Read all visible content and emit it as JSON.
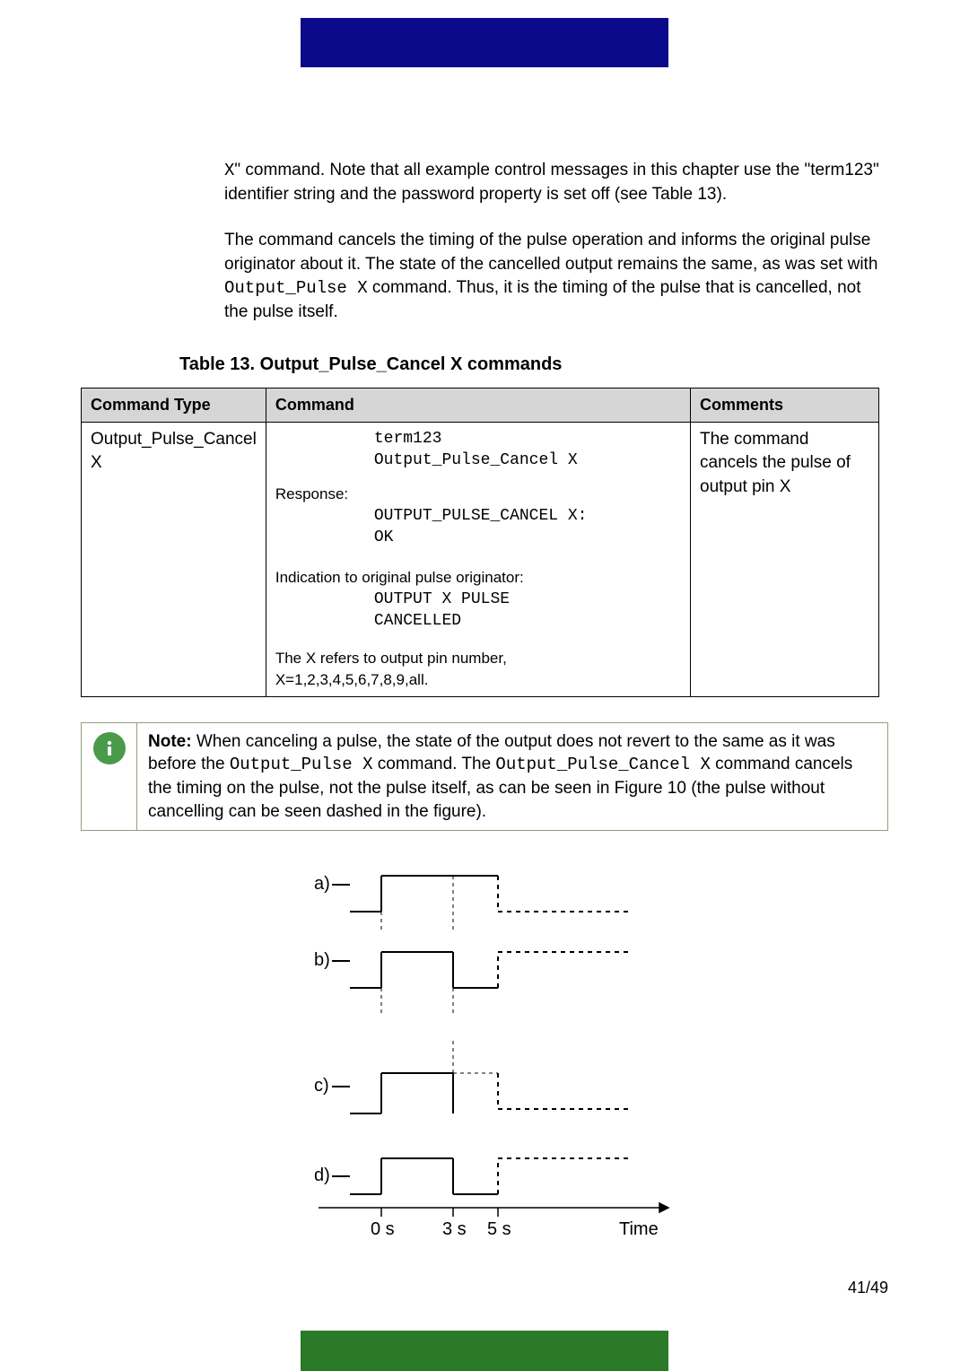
{
  "intro1_parts": {
    "p1": "X",
    "p2": "\" command. Note that all example control messages in this chapter use the \"term123\" identifier string and the password property is set off (see Table 13)."
  },
  "intro2_parts": {
    "p1": "The command cancels the timing of the pulse operation and informs the original pulse originator about it. The state of the cancelled output remains the same, as was set with ",
    "cmd": "Output_Pulse X",
    "p2": " command. Thus, it is the timing of the pulse that is cancelled, not the pulse itself."
  },
  "table_caption": "Table 13. Output_Pulse_Cancel X commands",
  "table": {
    "headers": {
      "c1": "Command Type",
      "c2": "Command",
      "c3": "Comments"
    },
    "row": {
      "type": "Output_Pulse_Cancel X",
      "cmd_line1": "term123",
      "cmd_line2": "Output_Pulse_Cancel X",
      "resp_label": "Response:",
      "resp_line1": "OUTPUT_PULSE_CANCEL X:",
      "resp_line2": "OK",
      "ind_label": "Indication to original pulse originator:",
      "ind_line1": "OUTPUT X  PULSE",
      "ind_line2": "CANCELLED",
      "footer1": "The X refers to output pin number,",
      "footer2": "X=1,2,3,4,5,6,7,8,9,all.",
      "comments": "The command cancels the pulse of output pin X"
    }
  },
  "note": {
    "bold": "Note:",
    "p1": " When canceling a pulse, the state of the output does not revert to the same as it was before the ",
    "c1": "Output_Pulse X",
    "p2": " command. The ",
    "c2": "Output_Pulse_Cancel X",
    "p3": " command cancels the timing on the pulse, not the pulse itself, as can be seen in Figure 10 (the pulse without cancelling can be seen dashed in the figure)."
  },
  "diagram": {
    "labels": {
      "a": "a)",
      "b": "b)",
      "c": "c)",
      "d": "d)"
    },
    "axis": {
      "t0": "0 s",
      "t3": "3 s",
      "t5": "5 s",
      "time": "Time"
    }
  },
  "page": "41/49",
  "chart_data": {
    "type": "signal-timing",
    "x_ticks": [
      0,
      3,
      5
    ],
    "x_unit": "s",
    "xlabel": "Time",
    "signals": [
      {
        "name": "a",
        "solid_high_range": [
          0,
          5
        ],
        "dashed_after": 5,
        "dashed_level": "low"
      },
      {
        "name": "b",
        "solid_high_range": [
          0,
          3
        ],
        "dashed_after": 5,
        "dashed_level": "high"
      },
      {
        "name": "c",
        "solid_high_range": [
          0,
          3
        ],
        "dashed_break_at": 5,
        "dashed_level": "low"
      },
      {
        "name": "d",
        "solid_high_range": [
          0,
          3
        ],
        "dashed_break_at": 5,
        "dashed_level": "high"
      }
    ]
  }
}
